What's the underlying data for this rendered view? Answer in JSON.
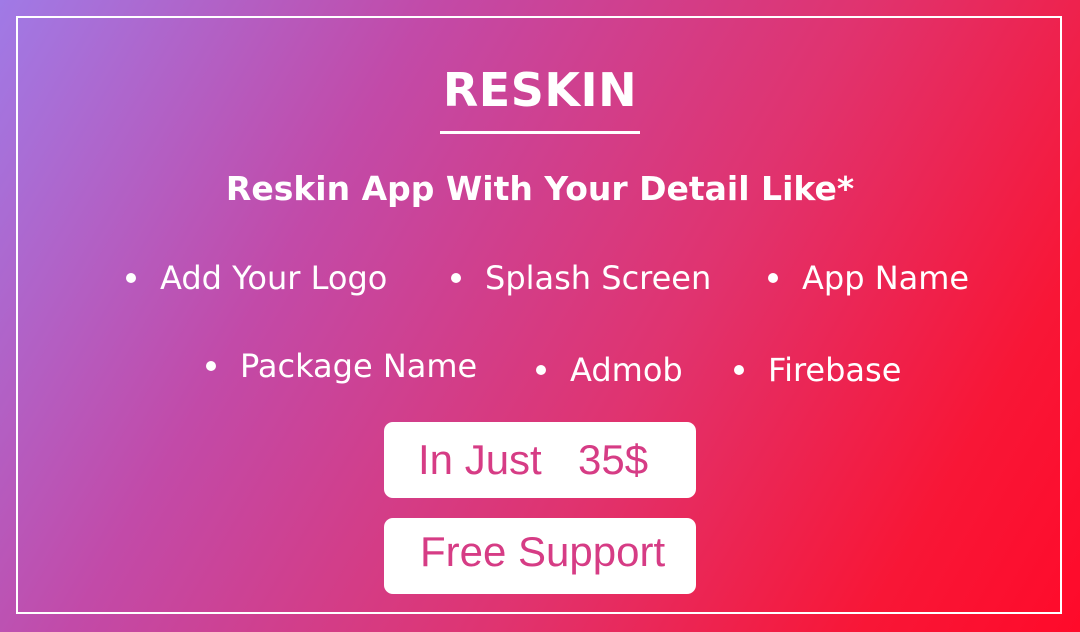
{
  "banner": {
    "title": "RESKIN",
    "subtitle": "Reskin App With Your Detail Like*",
    "features": [
      "Add Your Logo",
      "Splash Screen",
      "App Name",
      "Package Name",
      "Admob",
      "Firebase"
    ],
    "price_label": "In Just",
    "price_value": "35$",
    "support_label": "Free Support"
  },
  "colors": {
    "gradient_start": "#a07ae6",
    "gradient_end": "#ff0a2a",
    "button_text": "#d63c85",
    "text": "#ffffff"
  }
}
